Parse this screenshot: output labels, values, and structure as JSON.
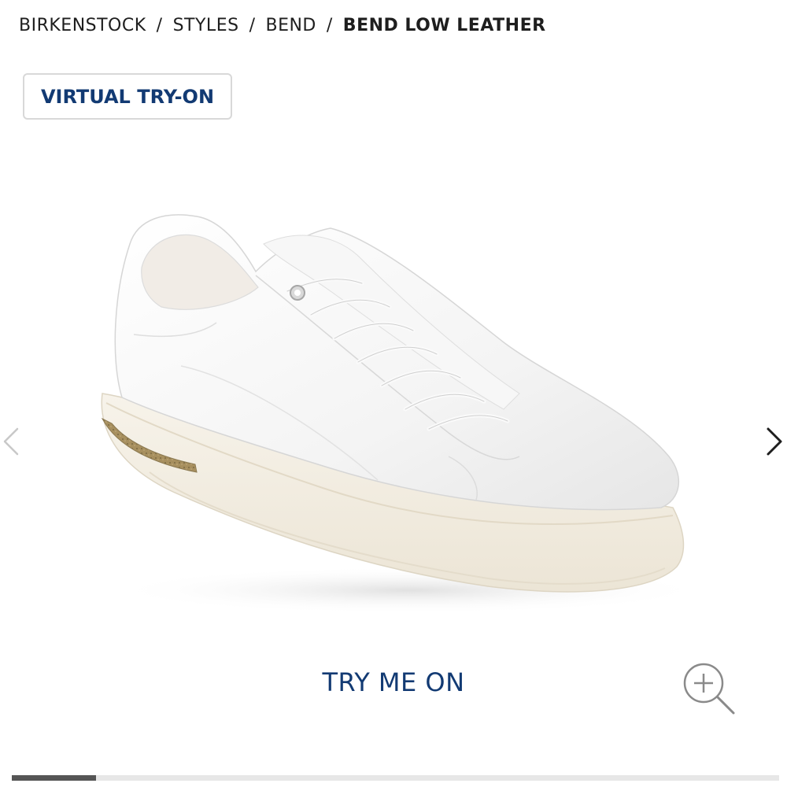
{
  "breadcrumb": {
    "items": [
      "BIRKENSTOCK",
      "STYLES",
      "BEND"
    ],
    "separator": "/",
    "current": "BEND LOW LEATHER"
  },
  "virtual_try_on": {
    "label": "VIRTUAL TRY-ON"
  },
  "gallery": {
    "image": "white leather low-top sneaker",
    "prev_icon": "chevron-left-icon",
    "next_icon": "chevron-right-icon",
    "zoom_icon": "zoom-in-icon",
    "progress": 0.11
  },
  "try_me_on": {
    "label": "TRY ME ON"
  },
  "colors": {
    "accent": "#123a73",
    "text": "#1e1e1e",
    "progress_fill": "#555555",
    "progress_track": "#e7e7e7"
  }
}
